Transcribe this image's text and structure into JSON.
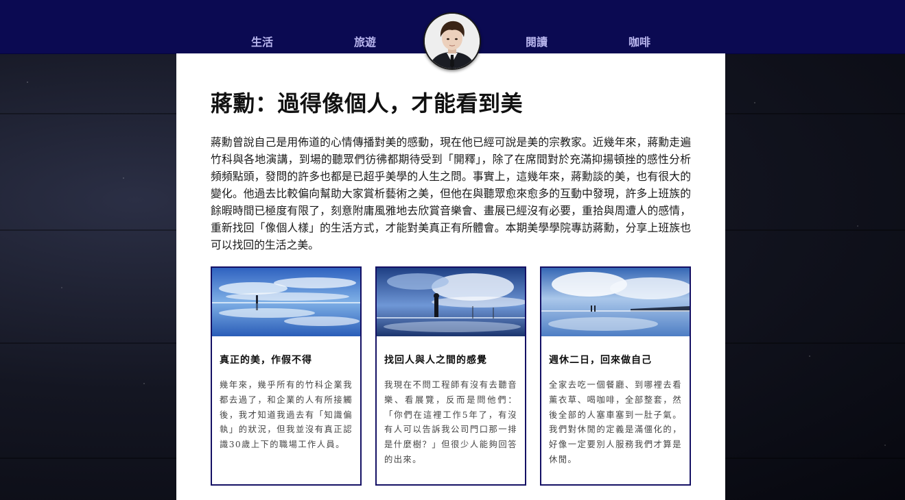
{
  "nav": {
    "items": [
      {
        "label": "生活"
      },
      {
        "label": "旅遊"
      },
      {
        "label": "閱讀"
      },
      {
        "label": "咖啡"
      }
    ]
  },
  "article": {
    "title": "蔣勳：過得像個人，才能看到美",
    "intro": "蔣勳曾說自己是用佈道的心情傳播對美的感動，現在他已經可說是美的宗教家。近幾年來，蔣勳走遍竹科與各地演講，到場的聽眾們彷彿都期待受到「開釋」，除了在席間對於充滿抑揚頓挫的感性分析頻頻點頭，發問的許多也都是已超乎美學的人生之問。事實上，這幾年來，蔣勳談的美，也有很大的變化。他過去比較偏向幫助大家賞析藝術之美，但他在與聽眾愈來愈多的互動中發現，許多上班族的餘暇時間已極度有限了，刻意附庸風雅地去欣賞音樂會、畫展已經沒有必要，重拾與周遭人的感情，重新找回「像個人樣」的生活方式，才能對美真正有所體會。本期美學學院專訪蔣勳，分享上班族也可以找回的生活之美。"
  },
  "cards": [
    {
      "title": "真正的美，作假不得",
      "body": "幾年來，幾乎所有的竹科企業我都去過了，和企業的人有所接觸後，我才知道我過去有「知識偏執」的狀況，但我並沒有真正認識30歲上下的職場工作人員。"
    },
    {
      "title": "找回人與人之間的感覺",
      "body": "我現在不問工程師有沒有去聽音樂、看展覽，反而是問他們：「你們在這裡工作5年了，有沒有人可以告訴我公司門口那一排是什麼樹？」但很少人能夠回答的出來。"
    },
    {
      "title": "週休二日，回來做自己",
      "body": "全家去吃一個餐廳、到哪裡去看薰衣草、喝咖啡，全部整套，然後全部的人塞車塞到一肚子氣。我們對休閒的定義是滿僵化的，好像一定要別人服務我們才算是休閒。"
    }
  ]
}
